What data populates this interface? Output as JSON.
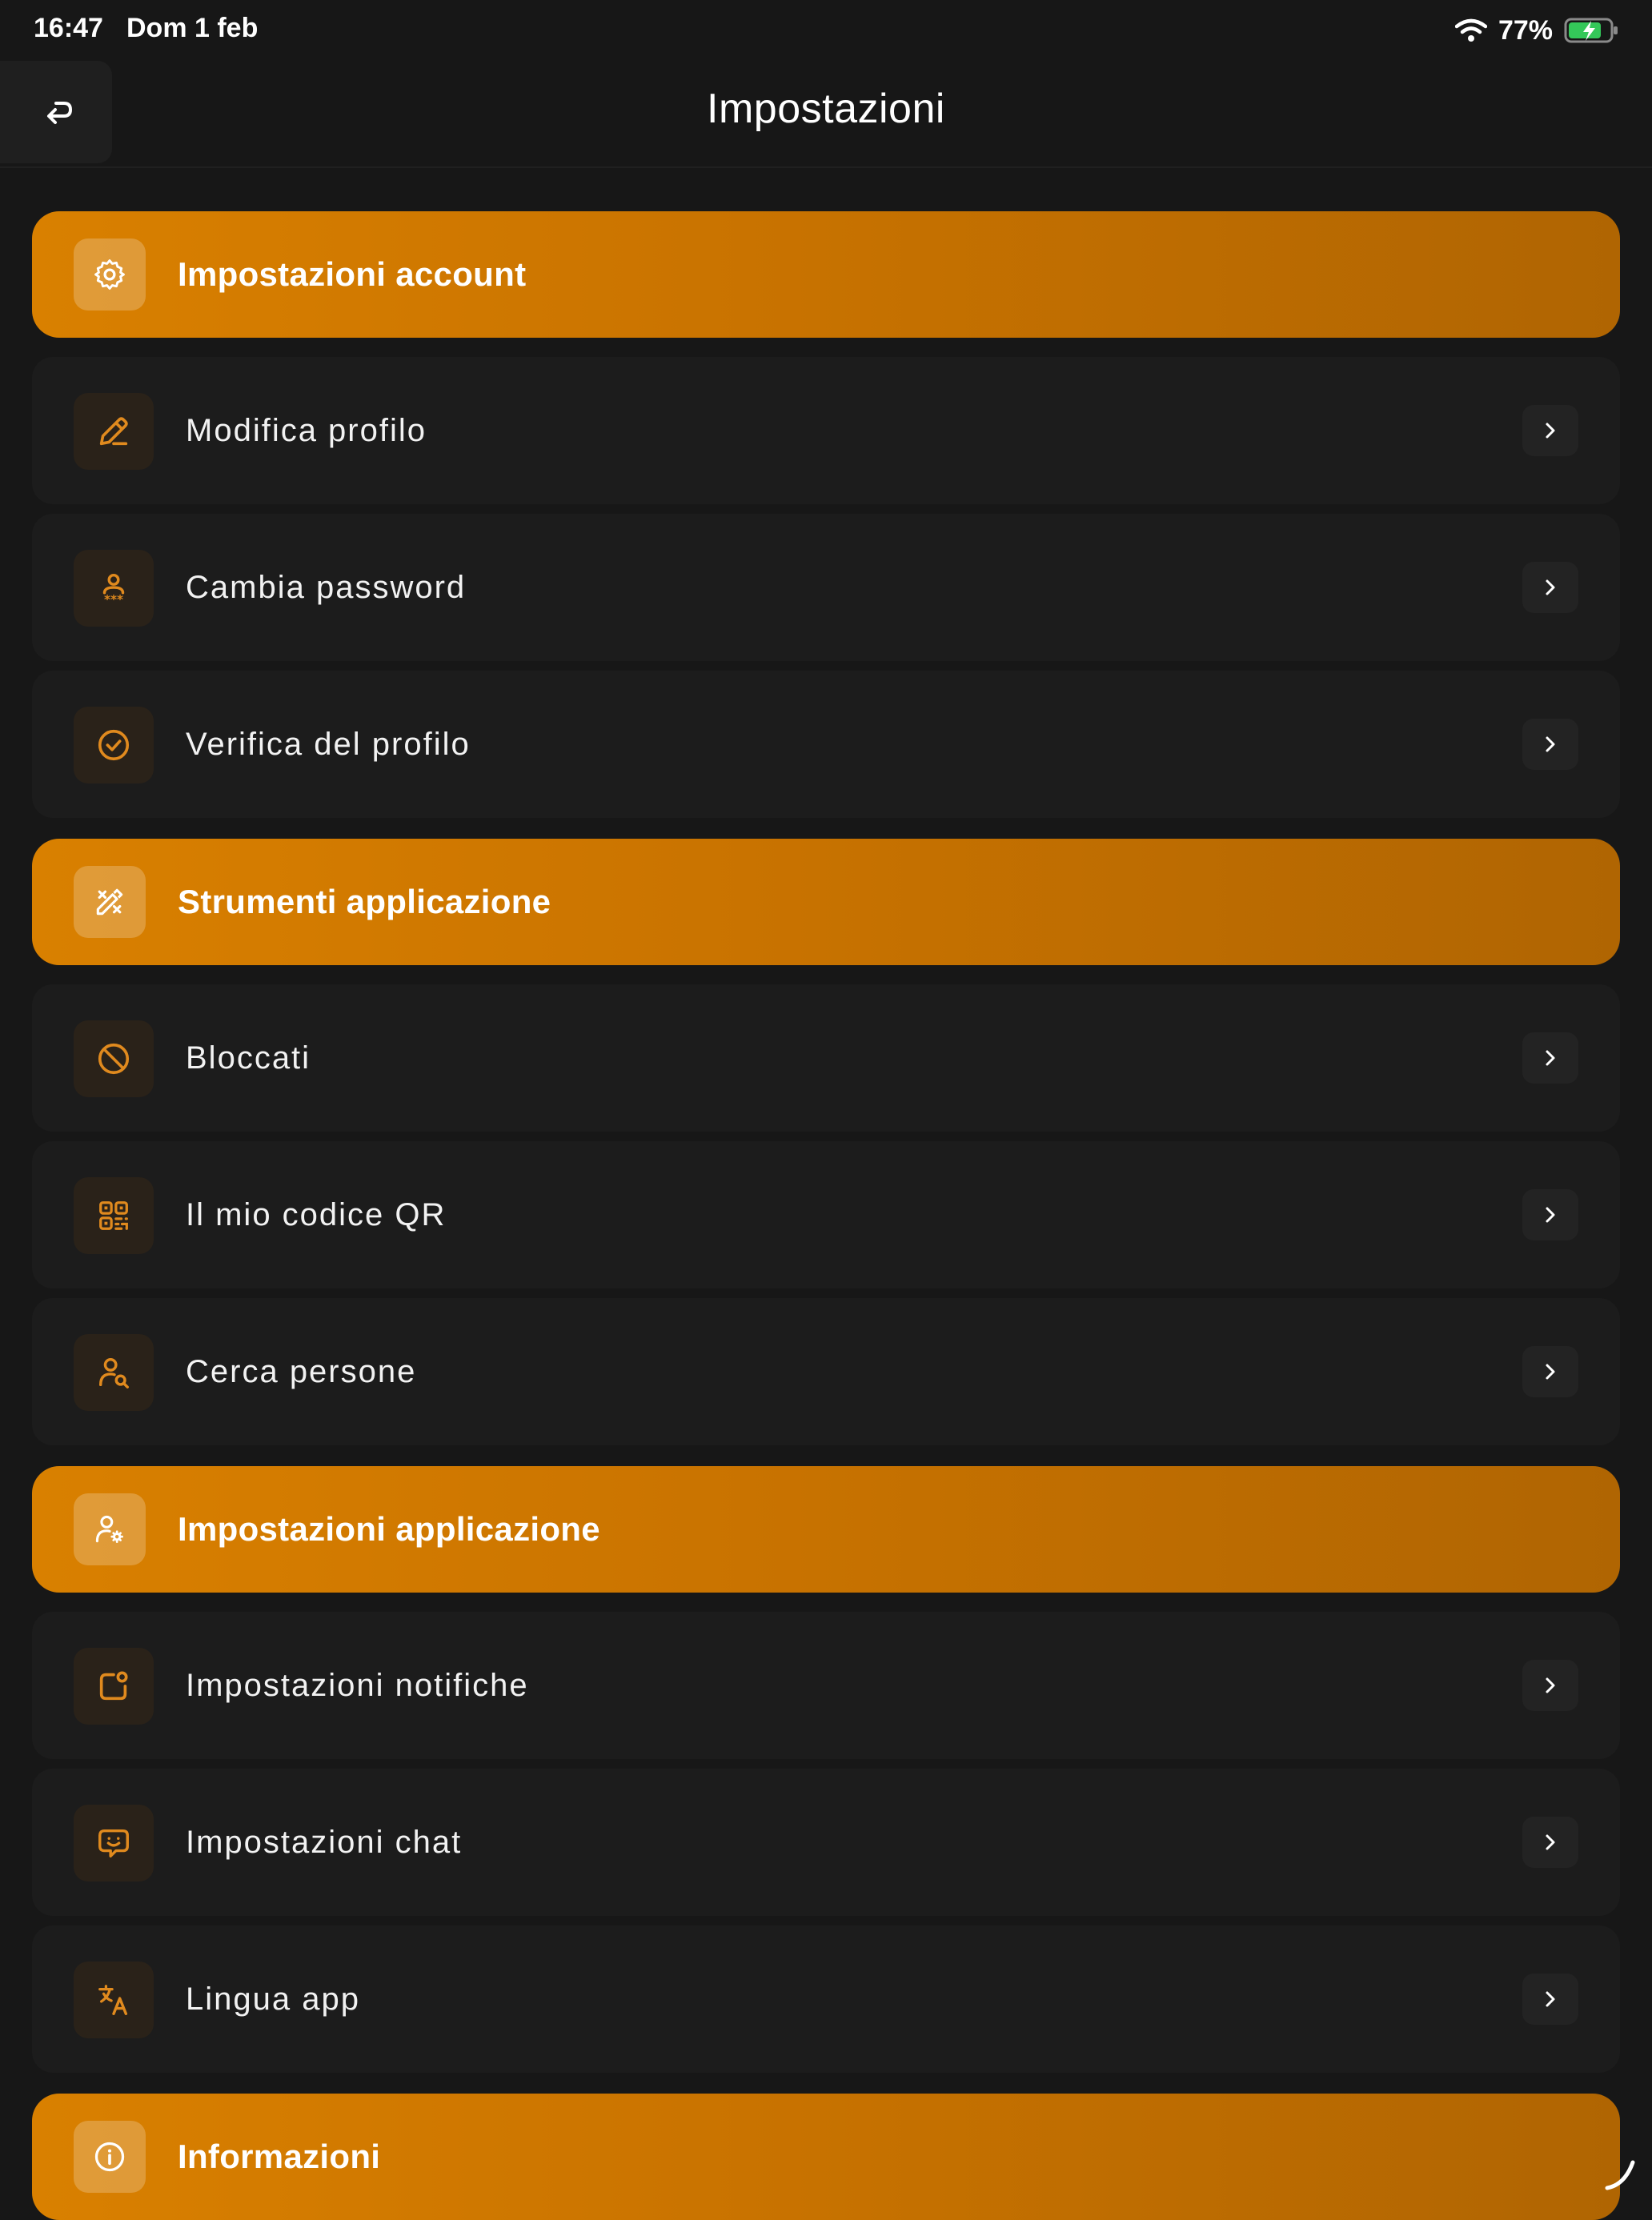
{
  "status_bar": {
    "time": "16:47",
    "date": "Dom 1 feb",
    "battery": "77%"
  },
  "nav": {
    "title": "Impostazioni"
  },
  "colors": {
    "accent": "#d98000",
    "accent_dark": "#b06502",
    "background": "#171717",
    "row": "#1c1c1c"
  },
  "sections": [
    {
      "title": "Impostazioni account",
      "icon": "gear-icon",
      "items": [
        {
          "label": "Modifica profilo",
          "icon": "pencil-icon"
        },
        {
          "label": "Cambia password",
          "icon": "user-password-icon"
        },
        {
          "label": "Verifica del profilo",
          "icon": "check-circle-icon"
        }
      ]
    },
    {
      "title": "Strumenti applicazione",
      "icon": "tools-icon",
      "items": [
        {
          "label": "Bloccati",
          "icon": "block-icon"
        },
        {
          "label": "Il mio codice QR",
          "icon": "qr-code-icon"
        },
        {
          "label": "Cerca persone",
          "icon": "user-search-icon"
        }
      ]
    },
    {
      "title": "Impostazioni applicazione",
      "icon": "user-gear-icon",
      "items": [
        {
          "label": "Impostazioni notifiche",
          "icon": "notification-icon"
        },
        {
          "label": "Impostazioni chat",
          "icon": "chat-smile-icon"
        },
        {
          "label": "Lingua app",
          "icon": "translate-icon"
        }
      ]
    },
    {
      "title": "Informazioni",
      "icon": "info-icon",
      "items": []
    }
  ]
}
